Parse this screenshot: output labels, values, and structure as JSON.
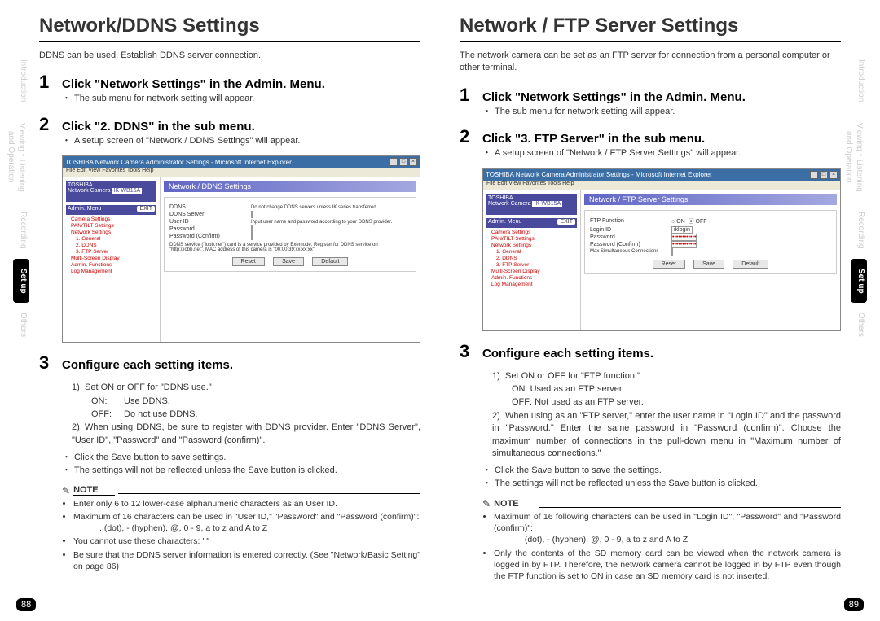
{
  "tabs": {
    "t1": "Introduction",
    "t2": "Viewing・Listening and Operation",
    "t3": "Recording",
    "t4": "Set up",
    "t5": "Others"
  },
  "left": {
    "title": "Network/DDNS Settings",
    "intro": "DDNS can be used.  Establish DDNS server connection.",
    "step1": {
      "title": "Click \"Network Settings\" in the Admin. Menu.",
      "body1": "The sub menu for network setting will appear."
    },
    "step2": {
      "title": "Click \"2. DDNS\" in the sub menu.",
      "body1": "A setup screen of \"Network / DDNS Settings\" will appear."
    },
    "step3": {
      "title": "Configure each setting items.",
      "d1": "Set ON or OFF for \"DDNS use.\"",
      "d1on": "ON:",
      "d1on_v": "Use DDNS.",
      "d1off": "OFF:",
      "d1off_v": "Do not use DDNS.",
      "d2": "When using DDNS, be sure to register with DDNS provider. Enter \"DDNS Server\", \"User ID\", \"Password\" and \"Password (confirm)\".",
      "save1": "Click the Save button to save settings.",
      "save2": "The settings will not be reflected unless the Save button is clicked."
    },
    "note": {
      "n1": "Enter only 6 to 12 lower-case alphanumeric characters as an User ID.",
      "n2": "Maximum of 16 characters can be used in \"User ID,\" \"Password\" and \"Password (confirm)\":",
      "n2chars": ". (dot), - (hyphen), @, 0 - 9, a to z and A to Z",
      "n3": "You cannot use these characters: ' \"",
      "n4": "Be sure that the DDNS server information is entered correctly.  (See \"Network/Basic Setting\" on page 86)"
    },
    "ss": {
      "title": "TOSHIBA Network Camera Administrator Settings - Microsoft Internet Explorer",
      "menu": "File  Edit  View  Favorites  Tools  Help",
      "logo1": "TOSHIBA",
      "logo2": "Network Camera",
      "model": "IK-WB15A",
      "admin": "Admin. Menu",
      "exit": "EXIT",
      "side1": "Camera Settings",
      "side2": "PAN/TILT Settings",
      "side3": "Network Settings",
      "side3a": "1. General",
      "side3b": "2. DDNS",
      "side3c": "3. FTP Server",
      "side4": "Multi-Screen Display",
      "side5": "Admin. Functions",
      "side6": "Log Management",
      "contenttitle": "Network / DDNS Settings",
      "l_ddns": "DDNS",
      "v_ddns": "Do not change DDNS servers unless IK series transferred.",
      "l_srv": "DDNS Server",
      "l_uid": "User ID",
      "v_uid": "Input user name and password according to your DDNS provider.",
      "l_pw": "Password",
      "l_pwc": "Password (Confirm)",
      "foot": "DDNS service (\"iobb.net\") card is a service provided by Exemode. Register for DDNS service on \"http://iobb.net\". MAC address of this camera is \"00:00:39:xx:xx:xx\".",
      "btn_reset": "Reset",
      "btn_save": "Save",
      "btn_default": "Default"
    },
    "pagenum": "88"
  },
  "right": {
    "title": "Network / FTP Server Settings",
    "intro": "The network camera can be set as an FTP server for connection from a personal computer or other terminal.",
    "step1": {
      "title": "Click \"Network Settings\" in the Admin. Menu.",
      "body1": "The sub menu for network setting will appear."
    },
    "step2": {
      "title": "Click \"3. FTP Server\" in the sub menu.",
      "body1": "A setup screen of \"Network / FTP Server Settings\" will appear."
    },
    "step3": {
      "title": "Configure each setting items.",
      "d1": "Set ON or OFF for \"FTP function.\"",
      "d1on": "ON:  Used as an FTP server.",
      "d1off": "OFF: Not used as an FTP server.",
      "d2": "When using as an \"FTP server,\" enter the user name in \"Login ID\" and the password in \"Password.\"  Enter the same password in \"Password (confirm)\".  Choose the maximum number of connections in the pull-down menu in \"Maximum number of simultaneous connections.\"",
      "save1": "Click the Save button to save the settings.",
      "save2": "The settings will not be reflected unless the Save button is clicked."
    },
    "note": {
      "n1": "Maximum of 16 following characters can be used in \"Login ID\", \"Password\" and \"Password (confirm)\":",
      "n1chars": ". (dot), - (hyphen), @, 0 - 9, a to z and A to Z",
      "n2": "Only the contents of the SD memory card can be viewed when the network camera is logged in by FTP.  Therefore, the network camera cannot be logged in by FTP even though the FTP function is set to ON in case an SD memory card is not inserted."
    },
    "ss": {
      "title": "TOSHIBA Network Camera Administrator Settings - Microsoft Internet Explorer",
      "menu": "File  Edit  View  Favorites  Tools  Help",
      "logo1": "TOSHIBA",
      "logo2": "Network Camera",
      "model": "IK-WB15A",
      "admin": "Admin. Menu",
      "exit": "EXIT",
      "side1": "Camera Settings",
      "side2": "PAN/TILT Settings",
      "side3": "Network Settings",
      "side3a": "1. General",
      "side3b": "2. DDNS",
      "side3c": "3. FTP Server",
      "side4": "Multi-Screen Display",
      "side5": "Admin. Functions",
      "side6": "Log Management",
      "contenttitle": "Network / FTP Server Settings",
      "l_ftp": "FTP Function",
      "v_on": "ON",
      "v_off": "OFF",
      "l_login": "Login ID",
      "v_login": "iklogin",
      "l_pw": "Password",
      "l_pwc": "Password (Confirm)",
      "l_max": "Max Simultaneous Connections",
      "btn_reset": "Reset",
      "btn_save": "Save",
      "btn_default": "Default"
    },
    "pagenum": "89"
  },
  "note_label": "NOTE"
}
